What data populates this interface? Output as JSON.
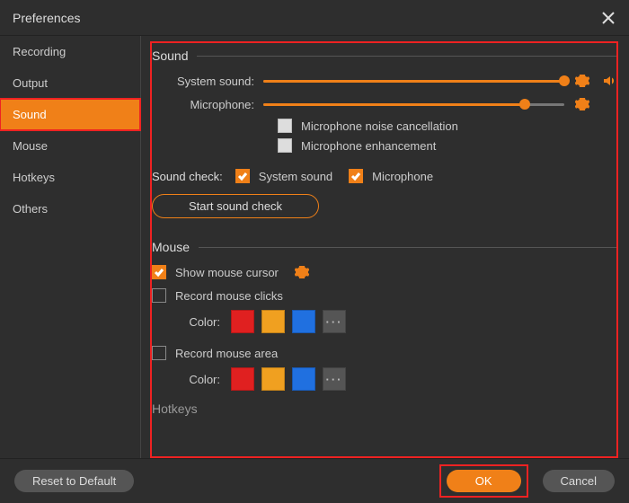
{
  "window": {
    "title": "Preferences"
  },
  "sidebar": {
    "items": [
      {
        "label": "Recording"
      },
      {
        "label": "Output"
      },
      {
        "label": "Sound"
      },
      {
        "label": "Mouse"
      },
      {
        "label": "Hotkeys"
      },
      {
        "label": "Others"
      }
    ],
    "active_index": 2
  },
  "sound": {
    "section_title": "Sound",
    "system_sound_label": "System sound:",
    "system_sound_value": 100,
    "microphone_label": "Microphone:",
    "microphone_value": 87,
    "noise_cancel_label": "Microphone noise cancellation",
    "noise_cancel_checked": false,
    "enhancement_label": "Microphone enhancement",
    "enhancement_checked": false,
    "sound_check_label": "Sound check:",
    "check_system_label": "System sound",
    "check_system_checked": true,
    "check_mic_label": "Microphone",
    "check_mic_checked": true,
    "start_check_label": "Start sound check"
  },
  "mouse": {
    "section_title": "Mouse",
    "show_cursor_label": "Show mouse cursor",
    "show_cursor_checked": true,
    "record_clicks_label": "Record mouse clicks",
    "record_clicks_checked": false,
    "record_area_label": "Record mouse area",
    "record_area_checked": false,
    "color_label": "Color:",
    "palette_clicks": [
      "#e02020",
      "#f0a020",
      "#2070e0"
    ],
    "palette_area": [
      "#e02020",
      "#f0a020",
      "#2070e0"
    ],
    "more_label": "···"
  },
  "peek": {
    "hotkeys_title": "Hotkeys"
  },
  "footer": {
    "reset_label": "Reset to Default",
    "ok_label": "OK",
    "cancel_label": "Cancel"
  }
}
